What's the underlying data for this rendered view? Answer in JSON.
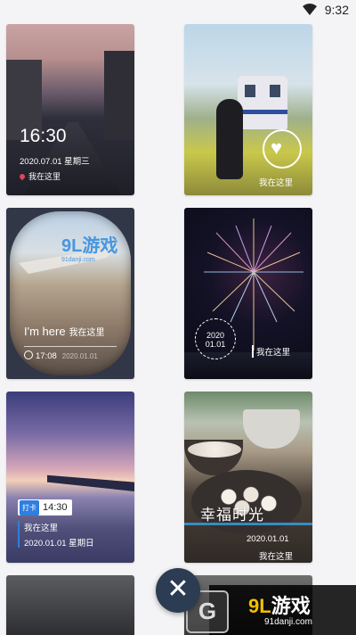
{
  "status_bar": {
    "time": "9:32"
  },
  "cards": [
    {
      "clock": "16:30",
      "date": "2020.07.01 星期三",
      "location": "我在这里"
    },
    {
      "caption": "我在这里"
    },
    {
      "headline": "I'm here",
      "headline_cn": "我在这里",
      "time": "17:08",
      "date": "2020.01.01",
      "watermark": "9L游戏",
      "watermark_url": "91danji.com"
    },
    {
      "stamp_year": "2020",
      "stamp_date": "01.01",
      "caption": "我在这里"
    },
    {
      "badge": "打卡",
      "time": "14:30",
      "location": "我在这里",
      "date": "2020.01.01  星期日"
    },
    {
      "title": "幸福时光",
      "date": "2020.01.01",
      "location": "我在这里"
    }
  ],
  "fab": {
    "icon": "close-icon",
    "symbol": "✕"
  },
  "watermark": {
    "logo_prefix": "9L",
    "logo_text": "游戏",
    "url": "91danji.com",
    "g_letter": "G"
  }
}
